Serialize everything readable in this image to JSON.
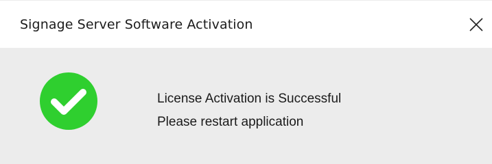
{
  "window": {
    "title": "Signage Server Software Activation",
    "close_icon": "close-icon"
  },
  "dialog": {
    "status_icon": "checkmark-circle-icon",
    "status_color": "#2ecc2e",
    "message_line1": "License Activation is Successful",
    "message_line2": "Please restart application"
  }
}
